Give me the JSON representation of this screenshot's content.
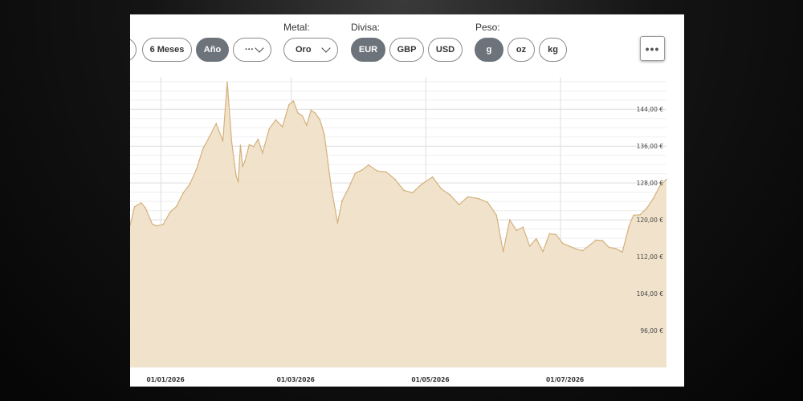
{
  "controls": {
    "periods": [
      "6 Meses",
      "Año"
    ],
    "active_period": "Año",
    "more_period_label": "···",
    "metal_label": "Metal:",
    "metal_value": "Oro",
    "currency_label": "Divisa:",
    "currencies": [
      "EUR",
      "GBP",
      "USD"
    ],
    "active_currency": "EUR",
    "weight_label": "Peso:",
    "weights": [
      "g",
      "oz",
      "kg"
    ],
    "active_weight": "g",
    "menu_label": "•••"
  },
  "colors": {
    "accent": "#6d737b",
    "area_fill": "#f0e2c8",
    "area_line": "#d4b07c",
    "grid": "#e6e6e6"
  },
  "chart_data": {
    "type": "area",
    "title": "",
    "xlabel": "",
    "ylabel": "",
    "ylim": [
      88,
      151
    ],
    "xlim": [
      "2025-12-18",
      "2026-08-18"
    ],
    "y_ticks": [
      96,
      104,
      112,
      120,
      128,
      136,
      144
    ],
    "y_tick_labels": [
      "96,00 €",
      "104,00 €",
      "112,00 €",
      "120,00 €",
      "128,00 €",
      "136,00 €",
      "144,00 €"
    ],
    "x_ticks": [
      "2026-01-01",
      "2026-03-01",
      "2026-05-01",
      "2026-07-01"
    ],
    "x_tick_labels": [
      "01/01/2026",
      "01/03/2026",
      "01/05/2026",
      "01/07/2026"
    ],
    "grid": true,
    "series": [
      {
        "x": [
          "2025-12-18",
          "2025-12-20",
          "2025-12-23",
          "2025-12-25",
          "2025-12-28",
          "2025-12-30",
          "2026-01-02",
          "2026-01-05",
          "2026-01-08",
          "2026-01-11",
          "2026-01-14",
          "2026-01-17",
          "2026-01-20",
          "2026-01-23",
          "2026-01-26",
          "2026-01-29",
          "2026-01-31",
          "2026-02-02",
          "2026-02-04",
          "2026-02-05",
          "2026-02-06",
          "2026-02-07",
          "2026-02-08",
          "2026-02-10",
          "2026-02-12",
          "2026-02-14",
          "2026-02-16",
          "2026-02-19",
          "2026-02-22",
          "2026-02-25",
          "2026-02-28",
          "2026-03-02",
          "2026-03-04",
          "2026-03-06",
          "2026-03-08",
          "2026-03-10",
          "2026-03-12",
          "2026-03-14",
          "2026-03-16",
          "2026-03-19",
          "2026-03-22",
          "2026-03-24",
          "2026-03-27",
          "2026-03-30",
          "2026-04-02",
          "2026-04-05",
          "2026-04-09",
          "2026-04-13",
          "2026-04-17",
          "2026-04-21",
          "2026-04-25",
          "2026-04-29",
          "2026-05-04",
          "2026-05-08",
          "2026-05-12",
          "2026-05-16",
          "2026-05-20",
          "2026-05-25",
          "2026-05-29",
          "2026-06-02",
          "2026-06-05",
          "2026-06-08",
          "2026-06-11",
          "2026-06-14",
          "2026-06-17",
          "2026-06-20",
          "2026-06-23",
          "2026-06-26",
          "2026-06-29",
          "2026-07-02",
          "2026-07-05",
          "2026-07-08",
          "2026-07-11",
          "2026-07-14",
          "2026-07-17",
          "2026-07-20",
          "2026-07-23",
          "2026-07-26",
          "2026-07-29",
          "2026-08-01",
          "2026-08-03",
          "2026-08-06",
          "2026-08-09",
          "2026-08-12",
          "2026-08-15",
          "2026-08-18"
        ],
        "values": [
          118.8,
          122.8,
          123.7,
          122.6,
          119.1,
          118.7,
          119.0,
          121.6,
          122.9,
          125.8,
          127.7,
          130.9,
          135.4,
          138.1,
          140.9,
          137.1,
          149.9,
          136.9,
          129.6,
          128.2,
          136.2,
          131.6,
          132.7,
          136.3,
          135.9,
          137.5,
          134.5,
          139.7,
          141.7,
          140.2,
          145.0,
          145.8,
          143.2,
          142.6,
          140.5,
          143.8,
          143.1,
          141.7,
          138.5,
          127.4,
          119.3,
          124.1,
          126.9,
          130.1,
          130.8,
          131.9,
          130.6,
          130.4,
          128.8,
          126.4,
          125.9,
          127.7,
          129.3,
          126.7,
          125.4,
          123.3,
          125.0,
          124.6,
          123.8,
          121.0,
          113.1,
          120.0,
          117.7,
          118.4,
          114.3,
          115.9,
          113.1,
          117.0,
          116.8,
          114.9,
          114.3,
          113.7,
          113.3,
          114.4,
          115.6,
          115.5,
          114.0,
          113.8,
          113.0,
          118.6,
          121.0,
          121.1,
          122.5,
          124.6,
          127.4,
          128.8
        ]
      }
    ]
  }
}
